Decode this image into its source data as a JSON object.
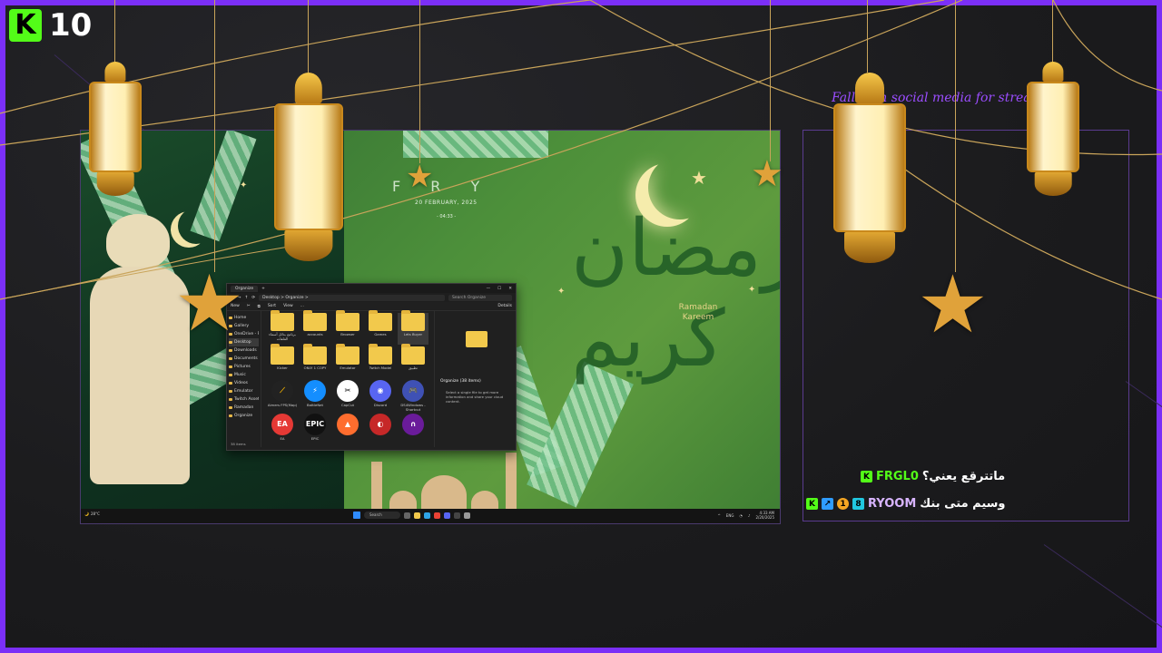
{
  "kick": {
    "logo_letter": "K",
    "viewer_count": "10",
    "brand_color": "#53fc18"
  },
  "frame": {
    "border_color": "#7b2ff7",
    "promo_text": "Fall... on social media for strea... es"
  },
  "screen": {
    "lock_clock": "F   R   Y",
    "date": "20 FEBRUARY, 2025",
    "time": "- 04:33 -",
    "wallpaper_text": "Ramadan Kareem",
    "wallpaper_calligraphy": "رمضان كريم",
    "explorer": {
      "tab_title": "Organize",
      "path": "Desktop  >  Organize  >",
      "search_placeholder": "Search Organize",
      "toolbar": [
        "New",
        "Sort",
        "View",
        "..."
      ],
      "details_label": "Details",
      "nav_items": [
        "Home",
        "Gallery",
        "OneDrive - Perso",
        "Desktop",
        "Downloads",
        "Documents",
        "Pictures",
        "Music",
        "Videos",
        "Emulator",
        "Twitch Assets",
        "Ramadan",
        "Organize"
      ],
      "nav_selected": "Desktop",
      "items": [
        {
          "label": "برنامج بدائل أسماء الملفات",
          "type": "folder"
        },
        {
          "label": "accounts",
          "type": "folder"
        },
        {
          "label": "Browser",
          "type": "folder"
        },
        {
          "label": "Games",
          "type": "folder"
        },
        {
          "label": "Lets Buyer",
          "type": "folder"
        },
        {
          "label": "Kicker",
          "type": "folder"
        },
        {
          "label": "ONLY 1 COPY",
          "type": "folder"
        },
        {
          "label": "Emulator",
          "type": "folder"
        },
        {
          "label": "Twitch Model",
          "type": "folder"
        },
        {
          "label": "تطبيق",
          "type": "folder"
        },
        {
          "label": "Aimers FPS(Map)",
          "type": "app"
        },
        {
          "label": "BattleNet",
          "type": "app"
        },
        {
          "label": "CapCut",
          "type": "app"
        },
        {
          "label": "Discord",
          "type": "app"
        },
        {
          "label": "DS4Windows - Shortcut",
          "type": "app"
        },
        {
          "label": "EA",
          "type": "app"
        },
        {
          "label": "EPIC",
          "type": "app"
        },
        {
          "label": "",
          "type": "app"
        },
        {
          "label": "",
          "type": "app"
        },
        {
          "label": "",
          "type": "app"
        }
      ],
      "preview_title": "Organize (38 items)",
      "preview_desc": "Select a single file to get more information and share your cloud content.",
      "status": "38 items"
    },
    "taskbar": {
      "weather": "28°C",
      "search_label": "Search",
      "tray_lang": "ENG",
      "tray_time": "4:33 AM",
      "tray_date": "2/20/2025"
    }
  },
  "chat": {
    "messages": [
      {
        "username": "FRGL0",
        "text": "ماتترقع يعني؟",
        "badges": [
          "kick-icon"
        ],
        "color": "#53fc18"
      },
      {
        "username": "RYOOM",
        "text": "وسيم متى بنك",
        "badges": [
          "kick-icon",
          "sub-icon",
          "gift-icon",
          "og-icon"
        ],
        "color": "#d8b4ff"
      }
    ]
  },
  "colors": {
    "accent": "#7b2ff7",
    "gold": "#e0a23a",
    "wallpaper_green": "#4c8f3a"
  }
}
